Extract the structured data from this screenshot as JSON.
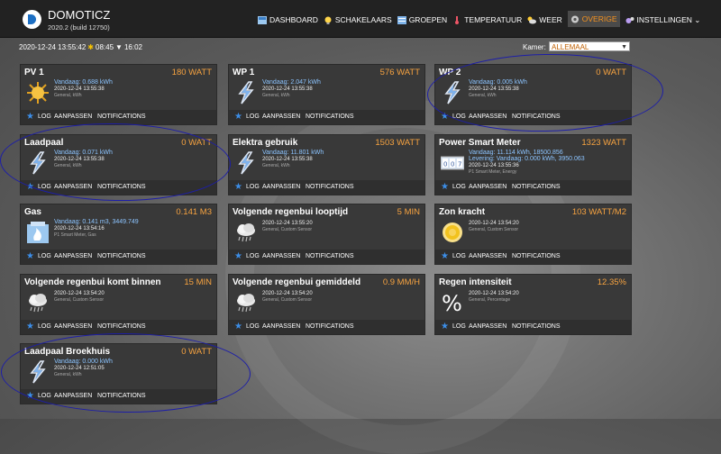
{
  "header": {
    "title": "DOMOTICZ",
    "version": "2020.2 (build 12750)",
    "nav": [
      {
        "label": "DASHBOARD",
        "icon": "dashboard-icon",
        "active": false
      },
      {
        "label": "SCHAKELAARS",
        "icon": "bulb-icon",
        "active": false
      },
      {
        "label": "GROEPEN",
        "icon": "groups-icon",
        "active": false
      },
      {
        "label": "TEMPERATUUR",
        "icon": "thermometer-icon",
        "active": false
      },
      {
        "label": "WEER",
        "icon": "weather-icon",
        "active": false
      },
      {
        "label": "OVERIGE",
        "icon": "utility-icon",
        "active": true
      },
      {
        "label": "INSTELLINGEN ⌄",
        "icon": "settings-icon",
        "active": false
      }
    ]
  },
  "status": {
    "datetime": "2020-12-24 13:55:42",
    "sunrise": "08:45",
    "sunset": "16:02"
  },
  "room_filter": {
    "label": "Kamer:",
    "value": "ALLEMAAL"
  },
  "footer_labels": {
    "log": "LOG",
    "adjust": "AANPASSEN",
    "notifications": "NOTIFICATIONS"
  },
  "tiles": [
    {
      "name": "PV 1",
      "value": "180 WATT",
      "line1": "Vandaag: 0.688 kWh",
      "line2": "",
      "timestamp": "2020-12-24 13:55:38",
      "type": "General, kWh",
      "icon": "sun-icon"
    },
    {
      "name": "WP 1",
      "value": "576 WATT",
      "line1": "Vandaag: 2.047 kWh",
      "line2": "",
      "timestamp": "2020-12-24 13:55:38",
      "type": "General, kWh",
      "icon": "lightning-icon"
    },
    {
      "name": "WP 2",
      "value": "0 WATT",
      "line1": "Vandaag: 0.005 kWh",
      "line2": "",
      "timestamp": "2020-12-24 13:55:38",
      "type": "General, kWh",
      "icon": "lightning-icon"
    },
    {
      "name": "Laadpaal",
      "value": "0 WATT",
      "line1": "Vandaag: 0.071 kWh",
      "line2": "",
      "timestamp": "2020-12-24 13:55:38",
      "type": "General, kWh",
      "icon": "lightning-icon"
    },
    {
      "name": "Elektra gebruik",
      "value": "1503 WATT",
      "line1": "Vandaag: 11.801 kWh",
      "line2": "",
      "timestamp": "2020-12-24 13:55:38",
      "type": "General, kWh",
      "icon": "lightning-icon"
    },
    {
      "name": "Power Smart Meter",
      "value": "1323 WATT",
      "line1": "Vandaag: 11.114 kWh, 18500.856",
      "line2": "Levering: Vandaag: 0.000 kWh, 3950.063",
      "timestamp": "2020-12-24 13:55:36",
      "type": "P1 Smart Meter, Energy",
      "icon": "counter-icon"
    },
    {
      "name": "Gas",
      "value": "0.141 M3",
      "line1": "Vandaag: 0.141 m3, 3449.749",
      "line2": "",
      "timestamp": "2020-12-24 13:54:16",
      "type": "P1 Smart Meter, Gas",
      "icon": "gas-icon"
    },
    {
      "name": "Volgende regenbui looptijd",
      "value": "5 MIN",
      "line1": "",
      "line2": "",
      "timestamp": "2020-12-24 13:55:20",
      "type": "General, Custom Sensor",
      "icon": "rain-cloud-icon"
    },
    {
      "name": "Zon kracht",
      "value": "103 WATT/M2",
      "line1": "",
      "line2": "",
      "timestamp": "2020-12-24 13:54:20",
      "type": "General, Custom Sensor",
      "icon": "sun-power-icon"
    },
    {
      "name": "Volgende regenbui komt binnen",
      "value": "15 MIN",
      "line1": "",
      "line2": "",
      "timestamp": "2020-12-24 13:54:20",
      "type": "General, Custom Sensor",
      "icon": "rain-cloud-icon"
    },
    {
      "name": "Volgende regenbui gemiddeld",
      "value": "0.9 MM/H",
      "line1": "",
      "line2": "",
      "timestamp": "2020-12-24 13:54:20",
      "type": "General, Custom Sensor",
      "icon": "rain-cloud-icon"
    },
    {
      "name": "Regen intensiteit",
      "value": "12.35%",
      "line1": "",
      "line2": "",
      "timestamp": "2020-12-24 13:54:20",
      "type": "General, Percentage",
      "icon": "percent-icon"
    },
    {
      "name": "Laadpaal Broekhuis",
      "value": "0 WATT",
      "line1": "Vandaag: 0.000 kWh",
      "line2": "",
      "timestamp": "2020-12-24 12:51:05",
      "type": "General, kWh",
      "icon": "lightning-icon"
    }
  ],
  "colors": {
    "accent": "#f7a340",
    "link": "#8cc4ff",
    "tile_bg": "#393939",
    "annotation": "#1d1ea8"
  }
}
